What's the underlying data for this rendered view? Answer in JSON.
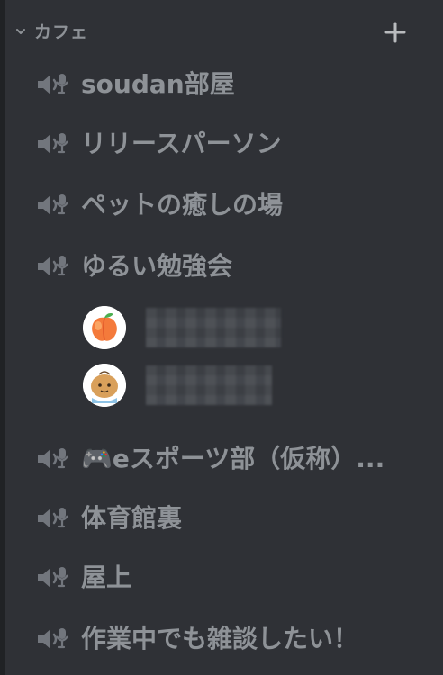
{
  "category": {
    "label": "カフェ",
    "collapse_icon": "chevron-down-icon",
    "add_icon": "plus-icon"
  },
  "channels": [
    {
      "name": "soudan部屋",
      "icon": "voice-channel-icon"
    },
    {
      "name": "リリースパーソン",
      "icon": "voice-channel-icon"
    },
    {
      "name": "ペットの癒しの場",
      "icon": "voice-channel-icon"
    },
    {
      "name": "ゆるい勉強会",
      "icon": "voice-channel-icon"
    },
    {
      "name": "🎮eスポーツ部（仮称）...",
      "icon": "voice-channel-icon"
    },
    {
      "name": "体育館裏",
      "icon": "voice-channel-icon"
    },
    {
      "name": "屋上",
      "icon": "voice-channel-icon"
    },
    {
      "name": "作業中でも雑談したい！",
      "icon": "voice-channel-icon"
    }
  ],
  "voice_users": [
    {
      "avatar": "peach-avatar",
      "name_blurred": true
    },
    {
      "avatar": "cartoon-character-avatar",
      "name_blurred": true
    }
  ],
  "colors": {
    "background": "#2f3136",
    "text_muted": "#8e9297",
    "edge": "#202225"
  }
}
